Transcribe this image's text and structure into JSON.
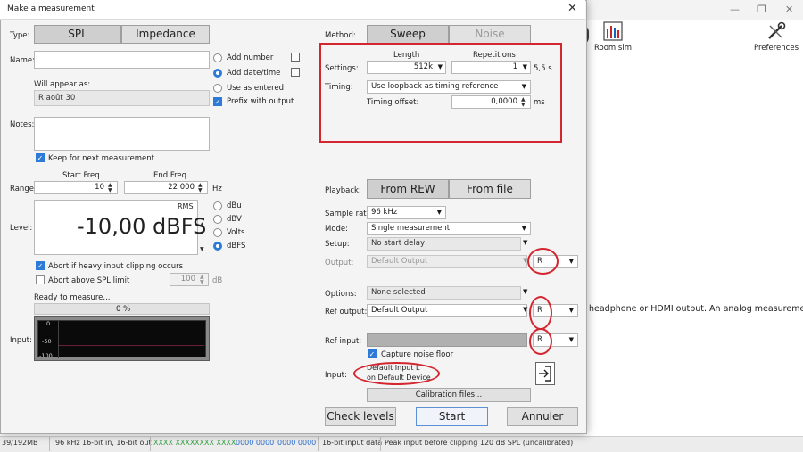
{
  "background": {
    "window_controls": {
      "minimize": "—",
      "maximize": "❐",
      "close": "✕"
    },
    "toolbar": [
      {
        "label": "Room sim",
        "icon": "bar-chart-icon"
      },
      {
        "label": "Preferences",
        "icon": "tools-icon"
      }
    ],
    "body_text": "headphone or HDMI output. An analog measurement",
    "status_bar": {
      "memory": "39/192MB",
      "rate": "96 kHz",
      "bits": "16-bit in, 16-bit out",
      "meter_a": "XXXX XXXX",
      "meter_b": "XXXX XXXX",
      "meter_c": "0000 0000",
      "meter_d": "0000 0000",
      "input_data": "16-bit input data",
      "peak": "Peak input before clipping 120 dB SPL (uncalibrated)"
    }
  },
  "dialog": {
    "title": "Make a measurement",
    "close": "✕",
    "type": {
      "label": "Type:",
      "spl": "SPL",
      "impedance": "Impedance"
    },
    "name": {
      "label": "Name:",
      "value": "",
      "add_number": "Add number",
      "add_date_time": "Add date/time",
      "use_as_entered": "Use as entered",
      "prefix_with_output": "Prefix with output",
      "will_appear_label": "Will appear as:",
      "will_appear_value": "R août 30"
    },
    "notes": {
      "label": "Notes:",
      "value": "",
      "keep": "Keep for next measurement"
    },
    "range": {
      "label": "Range:",
      "start_label": "Start Freq",
      "end_label": "End Freq",
      "start": "10",
      "end": "22 000",
      "unit": "Hz"
    },
    "level": {
      "label": "Level:",
      "mode": "RMS",
      "value": "-10,00 dBFS",
      "units": [
        "dBu",
        "dBV",
        "Volts",
        "dBFS"
      ],
      "selected_unit": "dBFS"
    },
    "abort_clipping": "Abort if heavy input clipping occurs",
    "abort_spl": {
      "label": "Abort above SPL limit",
      "value": "100",
      "unit": "dB"
    },
    "ready": "Ready to measure...",
    "progress": {
      "text": "0 %",
      "fraction": 0
    },
    "input_meter": {
      "label": "Input:",
      "ticks": [
        "0",
        "-50",
        "-100"
      ]
    },
    "method": {
      "label": "Method:",
      "sweep": "Sweep",
      "noise": "Noise"
    },
    "settings": {
      "label": "Settings:",
      "length_label": "Length",
      "length": "512k",
      "repetitions_label": "Repetitions",
      "repetitions": "1",
      "duration": "5,5 s"
    },
    "timing": {
      "label": "Timing:",
      "value": "Use loopback as timing reference",
      "offset_label": "Timing offset:",
      "offset": "0,0000",
      "offset_unit": "ms"
    },
    "playback": {
      "label": "Playback:",
      "from_rew": "From REW",
      "from_file": "From file"
    },
    "sample_rate": {
      "label": "Sample rate:",
      "value": "96 kHz"
    },
    "mode": {
      "label": "Mode:",
      "value": "Single measurement"
    },
    "setup": {
      "label": "Setup:",
      "value": "No start delay"
    },
    "output": {
      "label": "Output:",
      "value": "Default Output",
      "channel": "R"
    },
    "options": {
      "label": "Options:",
      "value": "None selected"
    },
    "ref_output": {
      "label": "Ref output:",
      "value": "Default Output",
      "channel": "R"
    },
    "ref_input": {
      "label": "Ref input:",
      "value": "",
      "channel": "R"
    },
    "capture_noise_floor": "Capture noise floor",
    "input": {
      "label": "Input:",
      "line1": "Default Input L",
      "line2": "on Default Device"
    },
    "calibration_files": "Calibration files...",
    "buttons": {
      "check_levels": "Check levels",
      "start": "Start",
      "cancel": "Annuler"
    },
    "colors": {
      "accent": "#2d7bd6",
      "annotation_red": "#d3262f",
      "meter_bg": "#0a0a0a"
    }
  }
}
